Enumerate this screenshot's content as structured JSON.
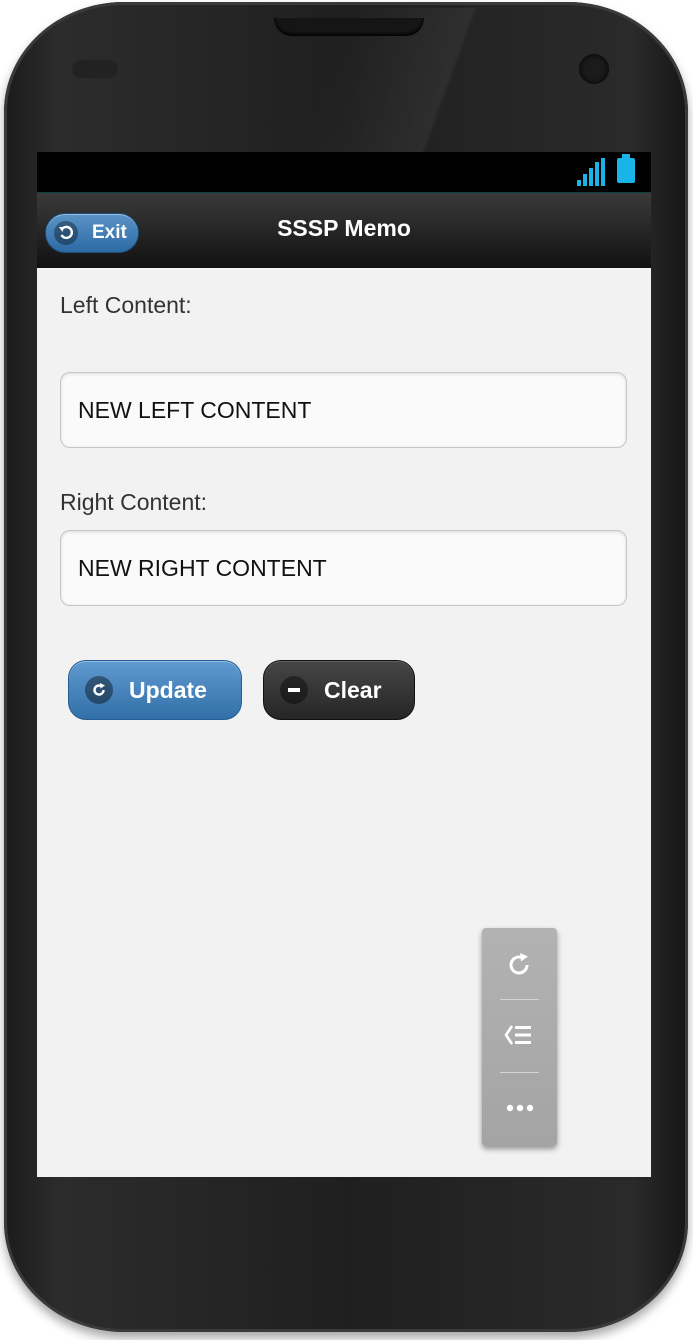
{
  "header": {
    "exit_label": "Exit",
    "title": "SSSP Memo"
  },
  "form": {
    "left_label": "Left Content:",
    "left_value": "NEW LEFT CONTENT",
    "right_label": "Right Content:",
    "right_value": "NEW RIGHT CONTENT"
  },
  "actions": {
    "update_label": "Update",
    "clear_label": "Clear"
  },
  "floating_menu": {
    "items": [
      "refresh-icon",
      "back-list-icon",
      "more-icon"
    ]
  },
  "colors": {
    "accent_blue": "#336fa8",
    "battery": "#19b4e8",
    "dark_button": "#262626"
  }
}
